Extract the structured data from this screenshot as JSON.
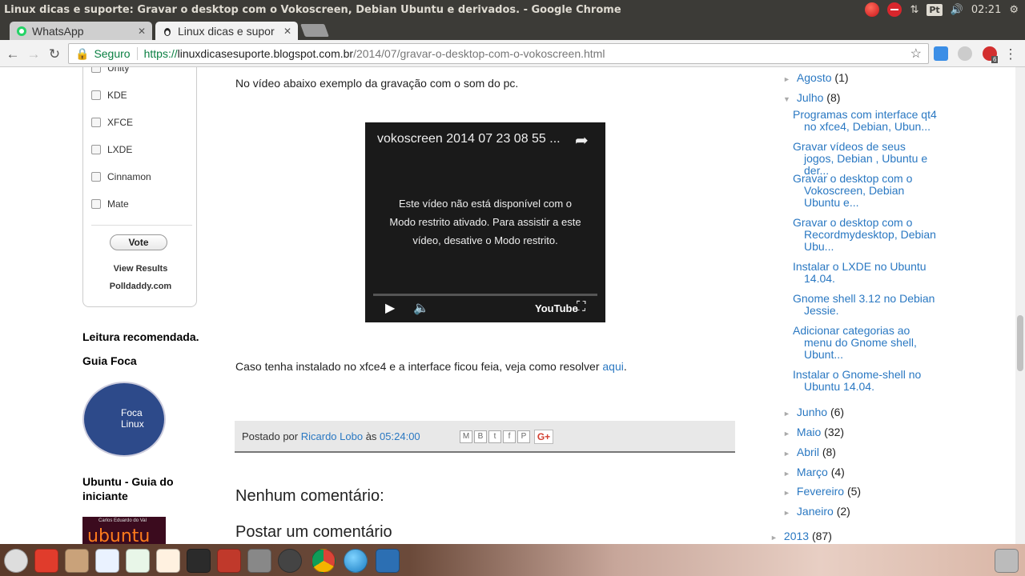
{
  "system_bar": {
    "window_title": "Linux dicas e suporte: Gravar o desktop com o Vokoscreen, Debian Ubuntu e derivados. - Google Chrome",
    "keyboard": "Pt",
    "clock": "02:21"
  },
  "tabs": [
    {
      "label": "WhatsApp",
      "icon": "whatsapp-icon"
    },
    {
      "label": "Linux dicas e supor",
      "icon": "tux-icon"
    }
  ],
  "address_bar": {
    "secure_label": "Seguro",
    "scheme": "https://",
    "host": "linuxdicasesuporte.blogspot.com.br",
    "path": "/2014/07/gravar-o-desktop-com-o-vokoscreen.html",
    "ext_badge": "6"
  },
  "poll": {
    "options": [
      "Unity",
      "KDE",
      "XFCE",
      "LXDE",
      "Cinnamon",
      "Mate"
    ],
    "vote_label": "Vote",
    "view_results": "View Results",
    "provider": "Polldaddy.com"
  },
  "sidebar_left": {
    "recommended_heading": "Leitura recomendada.",
    "foca_heading": "Guia Foca",
    "foca_image_text": "Foca Linux",
    "ubuntu_heading_line1": "Ubuntu - Guia do",
    "ubuntu_heading_line2": "iniciante",
    "ubuntu_book_author": "Carlos Eduardo do Val",
    "ubuntu_book_text": "ubuntu"
  },
  "post": {
    "intro": "No vídeo abaixo exemplo da gravação com o som do pc.",
    "video": {
      "title": "vokoscreen 2014 07 23 08 55 ...",
      "message": "Este vídeo não está disponível com o Modo restrito ativado. Para assistir a este vídeo, desative o Modo restrito.",
      "brand": "YouTube"
    },
    "after_text": "Caso tenha instalado no xfce4 e a interface ficou feia, veja como resolver ",
    "after_link": "aqui",
    "after_end": ".",
    "footer": {
      "posted_by": "Postado por",
      "author": "Ricardo Lobo",
      "at": "às",
      "time": "05:24:00"
    },
    "comments_heading": "Nenhum comentário:",
    "post_comment_heading": "Postar um comentário"
  },
  "archive": {
    "top": [
      {
        "label": "Agosto",
        "count": "(1)",
        "expanded": false
      },
      {
        "label": "Julho",
        "count": "(8)",
        "expanded": true
      }
    ],
    "july_posts": [
      "Programas com interface qt4 no xfce4, Debian, Ubun...",
      "Gravar vídeos de seus jogos, Debian , Ubuntu e der...",
      "Gravar o desktop com o Vokoscreen, Debian Ubuntu e...",
      "Gravar o desktop com o Recordmydesktop, Debian Ubu...",
      "Instalar o LXDE no Ubuntu 14.04.",
      "Gnome shell 3.12 no Debian Jessie.",
      "Adicionar categorias ao menu do Gnome shell, Ubunt...",
      "Instalar o Gnome-shell no Ubuntu 14.04."
    ],
    "months": [
      {
        "label": "Junho",
        "count": "(6)"
      },
      {
        "label": "Maio",
        "count": "(32)"
      },
      {
        "label": "Abril",
        "count": "(8)"
      },
      {
        "label": "Março",
        "count": "(4)"
      },
      {
        "label": "Fevereiro",
        "count": "(5)"
      },
      {
        "label": "Janeiro",
        "count": "(2)"
      }
    ],
    "year": {
      "label": "2013",
      "count": "(87)"
    }
  },
  "dock_icons": [
    "dash-icon",
    "back-icon",
    "files-icon",
    "writer-icon",
    "calc-icon",
    "impress-icon",
    "terminal-icon",
    "installer-icon",
    "settings-icon",
    "update-icon",
    "chrome-icon",
    "sphere-icon",
    "screenshot-icon",
    "trash-icon"
  ],
  "colors": {
    "link": "#2a78c2",
    "secure": "#0b8043",
    "panel": "#3c3b37"
  }
}
